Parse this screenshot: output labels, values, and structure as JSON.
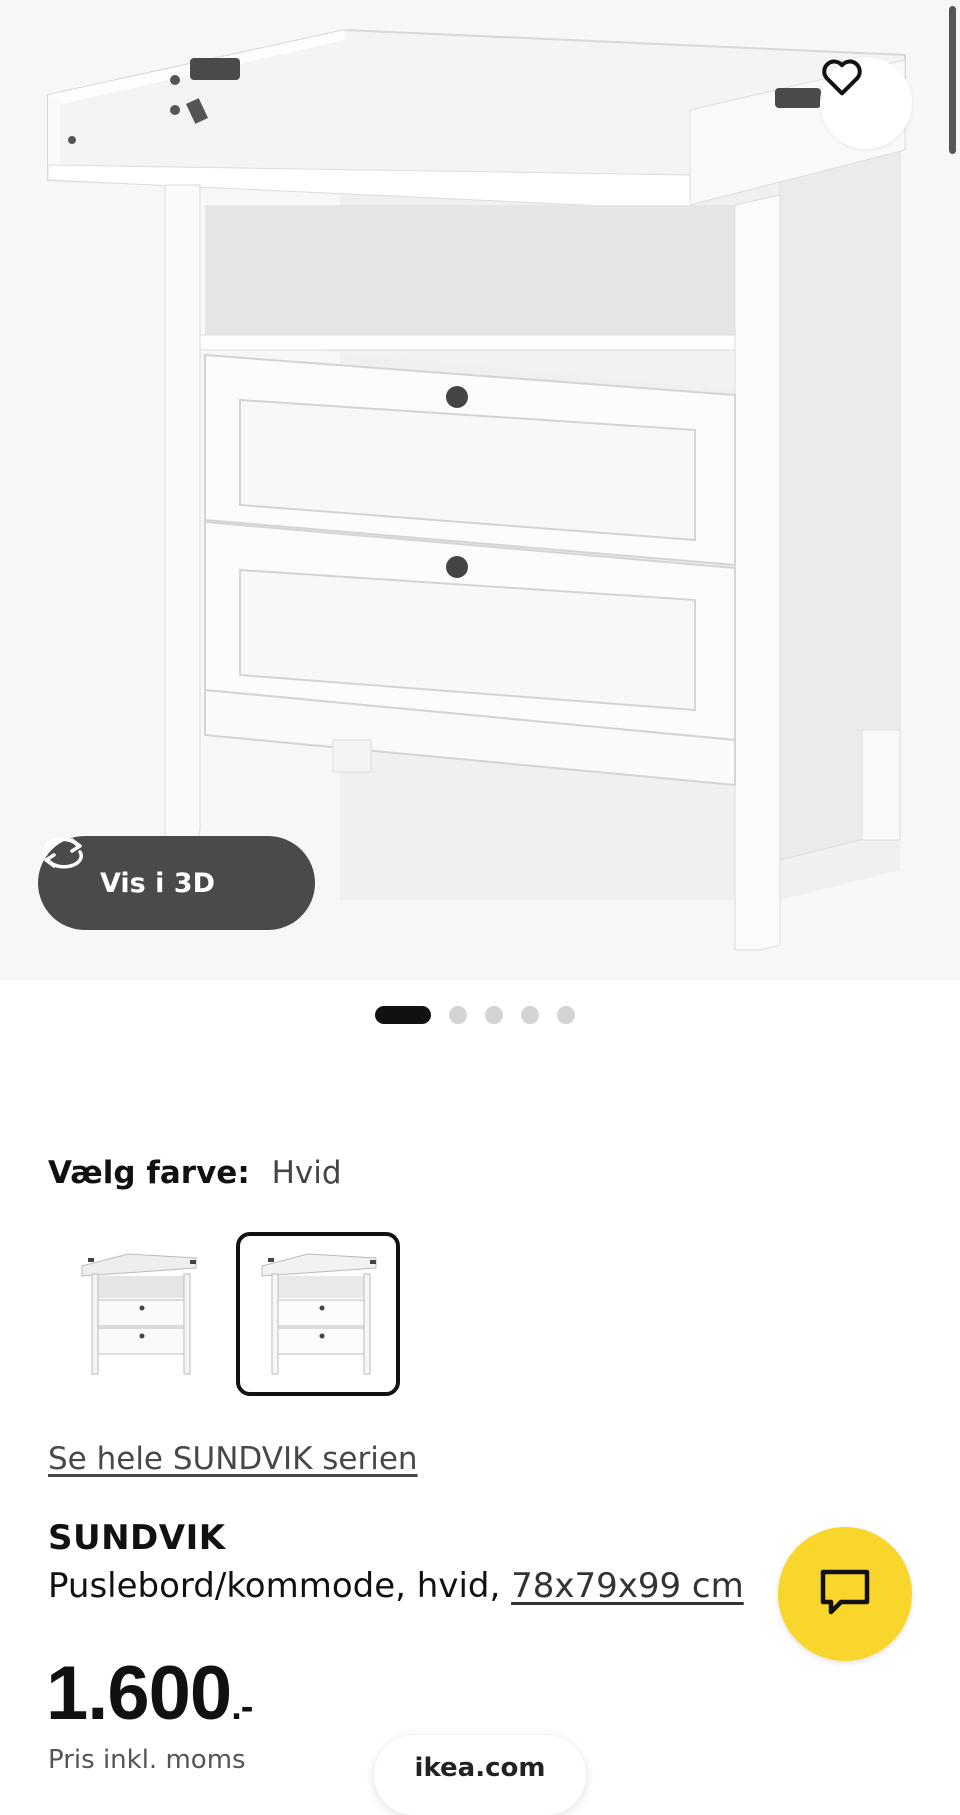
{
  "gallery": {
    "view_3d_label": "Vis i 3D",
    "dots_count": 5,
    "active_dot": 0
  },
  "color": {
    "label": "Vælg farve:",
    "value": "Hvid"
  },
  "series_link": "Se hele SUNDVIK serien",
  "product": {
    "name": "SUNDVIK",
    "description": "Puslebord/kommode, hvid,",
    "dimensions": "78x79x99 cm"
  },
  "price": {
    "amount": "1.600",
    "suffix": ".-",
    "note": "Pris inkl. moms"
  },
  "browser": {
    "url": "ikea.com"
  },
  "icons": {
    "favorite": "heart-icon",
    "view_3d": "rotate-3d-icon",
    "chat": "chat-bubble-icon"
  },
  "colors": {
    "chat_button": "#f9d62c",
    "dark_button": "#4a4a4a"
  }
}
